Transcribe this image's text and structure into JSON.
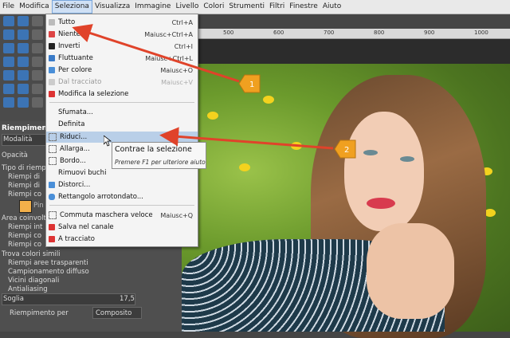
{
  "menubar": {
    "items": [
      "File",
      "Modifica",
      "Seleziona",
      "Visualizza",
      "Immagine",
      "Livello",
      "Colori",
      "Strumenti",
      "Filtri",
      "Finestre",
      "Aiuto"
    ],
    "active_index": 2
  },
  "select_menu": {
    "items": [
      {
        "label": "Tutto",
        "shortcut": "Ctrl+A",
        "icon": "select-all-icon",
        "disabled": false
      },
      {
        "label": "Niente",
        "shortcut": "Maiusc+Ctrl+A",
        "icon": "select-none-icon",
        "disabled": false
      },
      {
        "label": "Inverti",
        "shortcut": "Ctrl+I",
        "icon": "invert-icon",
        "disabled": false
      },
      {
        "label": "Fluttuante",
        "shortcut": "Maiusc+Ctrl+L",
        "icon": "float-icon",
        "disabled": false
      },
      {
        "label": "Per colore",
        "shortcut": "Maiusc+O",
        "icon": "by-color-icon",
        "disabled": false
      },
      {
        "label": "Dal tracciato",
        "shortcut": "Maiusc+V",
        "icon": "from-path-icon",
        "disabled": true
      },
      {
        "label": "Modifica la selezione",
        "shortcut": "",
        "icon": "edit-selection-icon",
        "disabled": false
      },
      {
        "label": "Sfumata...",
        "shortcut": "",
        "icon": "",
        "disabled": false
      },
      {
        "label": "Definita",
        "shortcut": "",
        "icon": "",
        "disabled": false
      },
      {
        "label": "Riduci...",
        "shortcut": "",
        "icon": "shrink-icon",
        "disabled": false
      },
      {
        "label": "Allarga...",
        "shortcut": "",
        "icon": "grow-icon",
        "disabled": false
      },
      {
        "label": "Bordo...",
        "shortcut": "",
        "icon": "border-icon",
        "disabled": false
      },
      {
        "label": "Rimuovi buchi",
        "shortcut": "",
        "icon": "",
        "disabled": false
      },
      {
        "label": "Distorci...",
        "shortcut": "",
        "icon": "distort-icon",
        "disabled": false
      },
      {
        "label": "Rettangolo arrotondato...",
        "shortcut": "",
        "icon": "rounded-rect-icon",
        "disabled": false
      },
      {
        "label": "Commuta maschera veloce",
        "shortcut": "Maiusc+Q",
        "icon": "quick-mask-icon",
        "disabled": false
      },
      {
        "label": "Salva nel canale",
        "shortcut": "",
        "icon": "save-channel-icon",
        "disabled": false
      },
      {
        "label": "A tracciato",
        "shortcut": "",
        "icon": "to-path-icon",
        "disabled": false
      }
    ]
  },
  "tooltip": {
    "title": "Contrae la selezione",
    "hint": "Premere F1 per ulteriore aiuto"
  },
  "ruler": {
    "ticks": [
      "500",
      "600",
      "700",
      "800",
      "900",
      "1000"
    ]
  },
  "dock": {
    "title": "Riempimento",
    "modalita": "Modalità",
    "opacita": "Opacità",
    "tipo": "Tipo di riempim",
    "riempi_1": "Riempi di",
    "riempi_2": "Riempi di",
    "riempi_3": "Riempi co",
    "pattern": "Pin",
    "area": "Area coinvolta",
    "area_1": "Riempi int",
    "area_2": "Riempi co",
    "area_3": "Riempi co",
    "trova": "Trova colori simili",
    "opt_1": "Riempi aree trasparenti",
    "opt_2": "Campionamento diffuso",
    "opt_3": "Vicini diagonali",
    "opt_4": "Antialiasing",
    "soglia_label": "Soglia",
    "soglia_value": "17,5",
    "riempimento_per": "Riempimento per",
    "composito": "Composito"
  },
  "markers": {
    "m1": "1",
    "m2": "2",
    "color": "#f0a020",
    "arrow_color": "#e0432a"
  }
}
